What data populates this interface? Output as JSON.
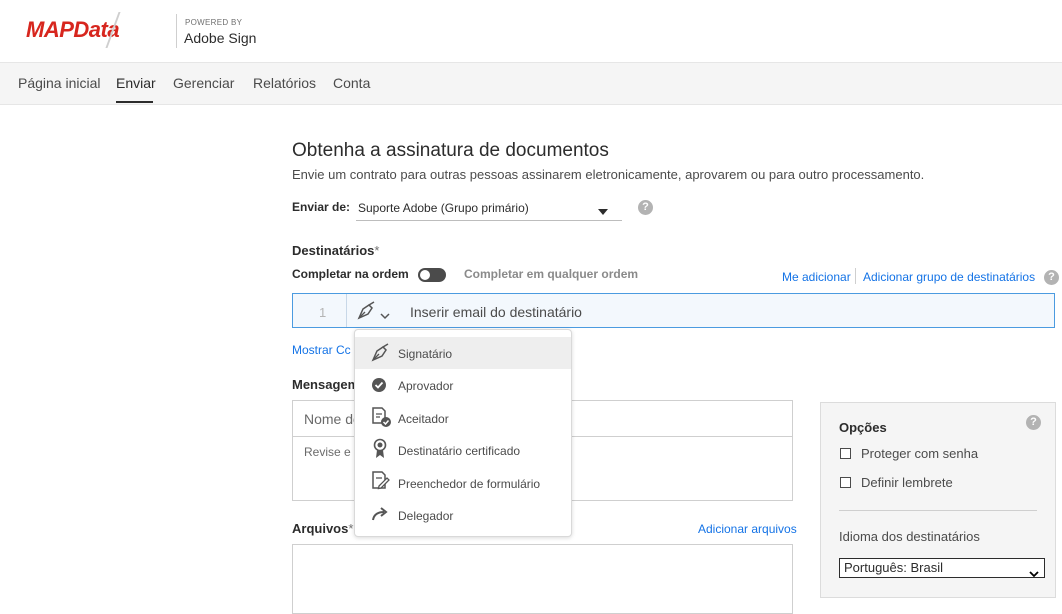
{
  "header": {
    "logo": "MAPData",
    "powered_by": "POWERED BY",
    "product": "Adobe Sign"
  },
  "nav": {
    "items": [
      "Página inicial",
      "Enviar",
      "Gerenciar",
      "Relatórios",
      "Conta"
    ],
    "active": "Enviar"
  },
  "page": {
    "title": "Obtenha a assinatura de documentos",
    "subtitle": "Envie um contrato para outras pessoas assinarem eletronicamente, aprovarem ou para outro processamento."
  },
  "send_from": {
    "label": "Enviar de:",
    "value": "Suporte Adobe (Grupo primário)"
  },
  "recipients": {
    "label": "Destinatários",
    "required": "*",
    "order_label": "Completar na ordem",
    "any_order_label": "Completar em qualquer ordem",
    "add_me": "Me adicionar",
    "add_group": "Adicionar grupo de destinatários",
    "row_number": "1",
    "email_placeholder": "Inserir email do destinatário",
    "show_cc": "Mostrar Cc"
  },
  "role_menu": {
    "items": [
      {
        "label": "Signatário",
        "icon": "pen-nib-icon"
      },
      {
        "label": "Aprovador",
        "icon": "check-circle-icon"
      },
      {
        "label": "Aceitador",
        "icon": "document-check-icon"
      },
      {
        "label": "Destinatário certificado",
        "icon": "ribbon-badge-icon"
      },
      {
        "label": "Preenchedor de formulário",
        "icon": "form-edit-icon"
      },
      {
        "label": "Delegador",
        "icon": "forward-arrow-icon"
      }
    ],
    "hovered": "Signatário"
  },
  "message": {
    "label": "Mensagem",
    "name_placeholder": "Nome do",
    "body_placeholder": "Revise e c"
  },
  "files": {
    "label": "Arquivos",
    "required": "*",
    "add_files": "Adicionar arquivos"
  },
  "options": {
    "title": "Opções",
    "protect_password": "Proteger com senha",
    "set_reminder": "Definir lembrete",
    "language_label": "Idioma dos destinatários",
    "language_value": "Português: Brasil"
  },
  "help_symbol": "?",
  "colors": {
    "brand_red": "#d7261e",
    "link_blue": "#1473e6",
    "row_border": "#4b9be0"
  }
}
